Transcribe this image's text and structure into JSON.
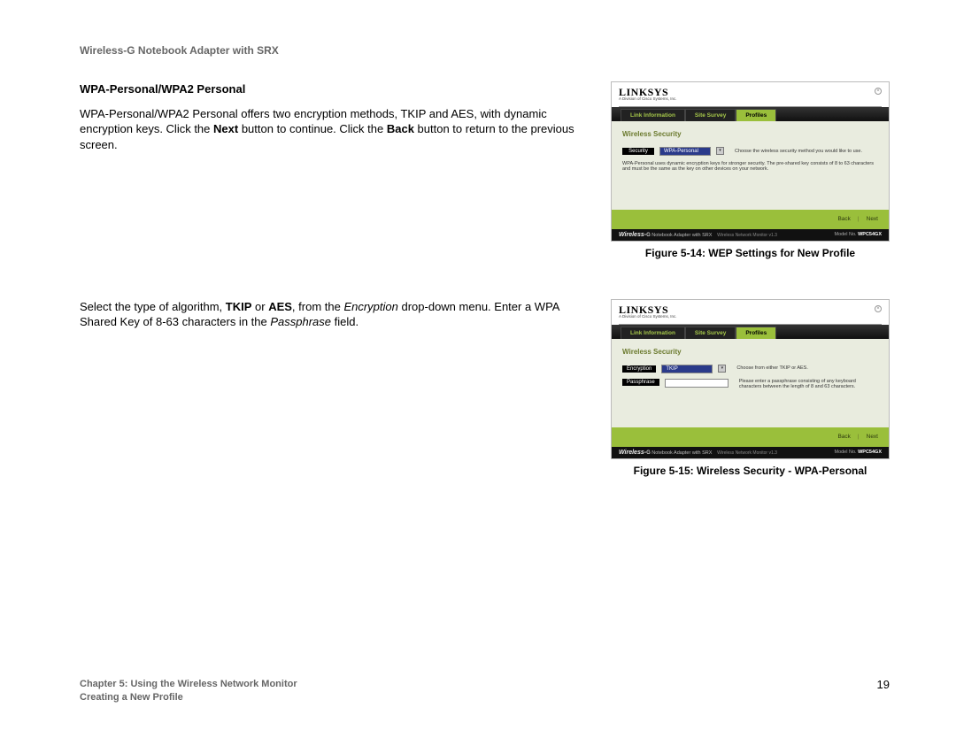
{
  "header": {
    "product": "Wireless-G Notebook Adapter with SRX"
  },
  "section": {
    "heading": "WPA-Personal/WPA2 Personal",
    "para1_a": "WPA-Personal/WPA2 Personal offers two encryption methods, TKIP and AES, with dynamic encryption keys. Click the ",
    "para1_next": "Next",
    "para1_b": " button to continue. Click the ",
    "para1_back": "Back",
    "para1_c": " button to return to the previous screen.",
    "para2_a": "Select the type of algorithm, ",
    "para2_tkip": "TKIP",
    "para2_or": " or ",
    "para2_aes": "AES",
    "para2_b": ", from the ",
    "para2_enc": "Encryption",
    "para2_c": " drop-down menu. Enter a WPA Shared Key of 8-63 characters in the ",
    "para2_pass": "Passphrase",
    "para2_d": " field."
  },
  "figure1": {
    "caption": "Figure 5-14: WEP Settings for New Profile",
    "panel": {
      "logo": "LINKSYS",
      "logo_sub": "A Division of Cisco Systems, Inc.",
      "tabs": {
        "t1": "Link Information",
        "t2": "Site Survey",
        "t3": "Profiles"
      },
      "body_title": "Wireless Security",
      "label_security": "Security",
      "value_security": "WPA-Personal",
      "hint_security": "Choose the wireless security method you would like to use.",
      "note": "WPA-Personal uses dynamic encryption keys for stronger security. The pre-shared key consists of 8 to 63 characters and must be the same as the key on other devices on your network.",
      "nav_back": "Back",
      "nav_next": "Next",
      "footer_wl": "Wireless-",
      "footer_g": "G",
      "footer_rest": " Notebook Adapter with SRX",
      "footer_ver": "Wireless Network Monitor v1.3",
      "footer_model_lbl": "Model No.",
      "footer_model": "WPC54GX"
    }
  },
  "figure2": {
    "caption": "Figure 5-15: Wireless Security - WPA-Personal",
    "panel": {
      "logo": "LINKSYS",
      "logo_sub": "A Division of Cisco Systems, Inc.",
      "tabs": {
        "t1": "Link Information",
        "t2": "Site Survey",
        "t3": "Profiles"
      },
      "body_title": "Wireless Security",
      "label_enc": "Encryption",
      "value_enc": "TKIP",
      "hint_enc": "Choose from either TKIP or AES.",
      "label_pass": "Passphrase",
      "hint_pass": "Please enter a passphrase consisting of any keyboard characters between the length of 8 and 63 characters.",
      "nav_back": "Back",
      "nav_next": "Next",
      "footer_wl": "Wireless-",
      "footer_g": "G",
      "footer_rest": " Notebook Adapter with SRX",
      "footer_ver": "Wireless Network Monitor v1.3",
      "footer_model_lbl": "Model No.",
      "footer_model": "WPC54GX"
    }
  },
  "footer": {
    "chapter": "Chapter 5: Using the Wireless Network Monitor",
    "subsection": "Creating a New Profile",
    "page": "19"
  }
}
